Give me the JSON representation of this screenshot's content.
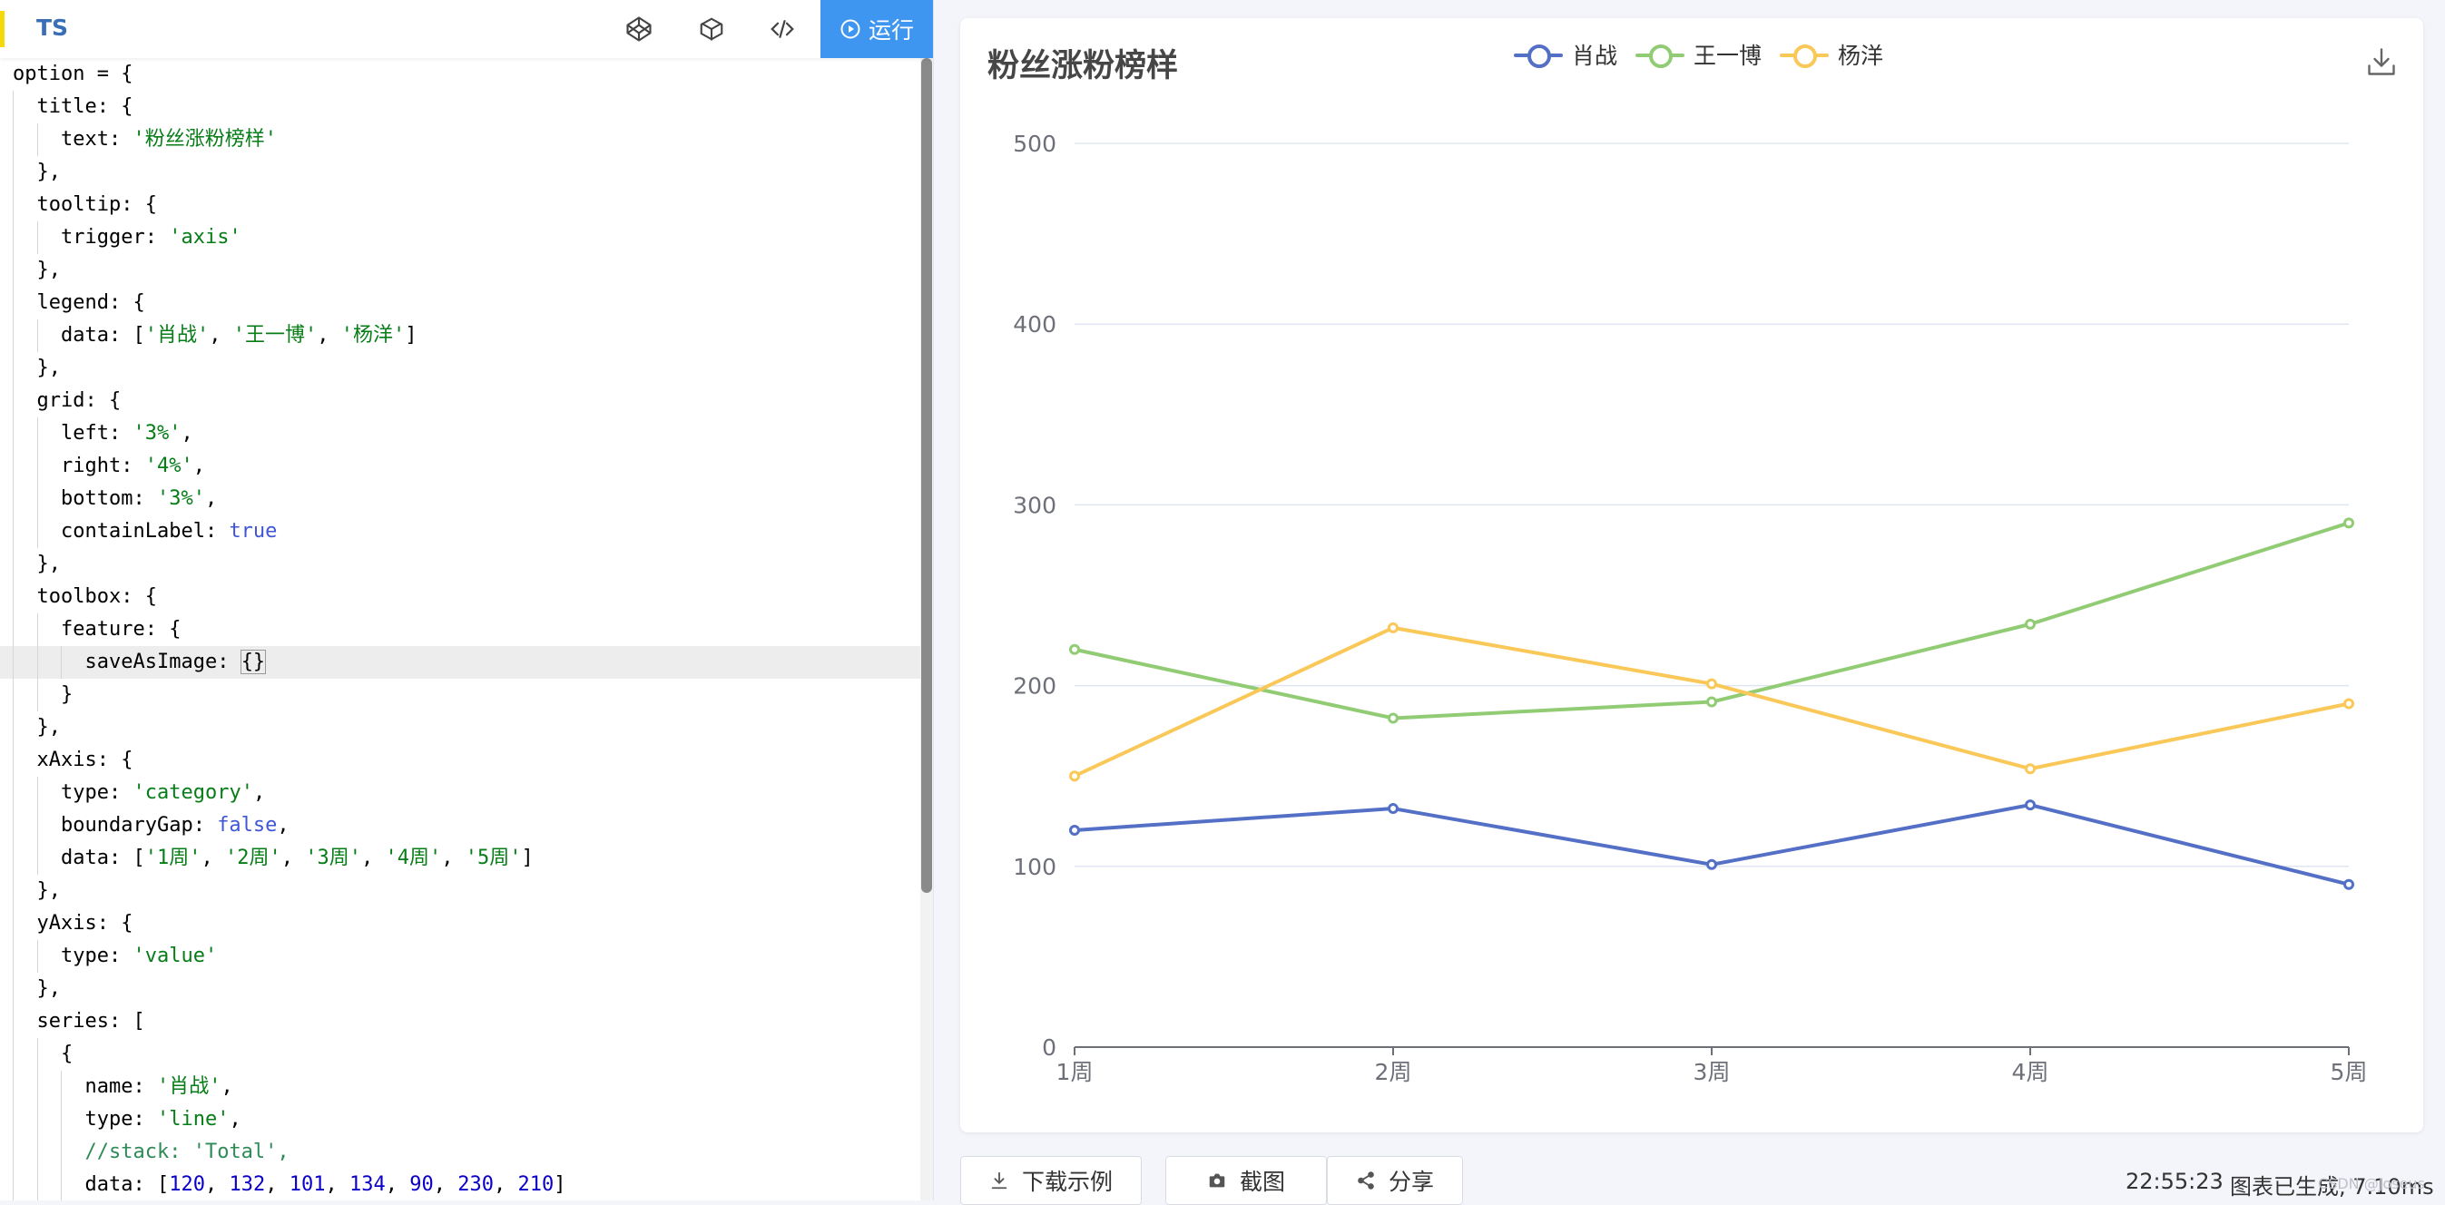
{
  "editor": {
    "language": "TS",
    "run_label": "运行",
    "toolbar_icons": [
      "codepen-icon",
      "box-icon",
      "code-icon"
    ],
    "code_lines": [
      {
        "indent": 0,
        "tokens": [
          {
            "t": "option = {"
          }
        ]
      },
      {
        "indent": 1,
        "tokens": [
          {
            "t": "title: {"
          }
        ]
      },
      {
        "indent": 2,
        "tokens": [
          {
            "t": "text: "
          },
          {
            "t": "'粉丝涨粉榜样'",
            "c": "str"
          }
        ]
      },
      {
        "indent": 1,
        "tokens": [
          {
            "t": "},"
          }
        ]
      },
      {
        "indent": 1,
        "tokens": [
          {
            "t": "tooltip: {"
          }
        ]
      },
      {
        "indent": 2,
        "tokens": [
          {
            "t": "trigger: "
          },
          {
            "t": "'axis'",
            "c": "str"
          }
        ]
      },
      {
        "indent": 1,
        "tokens": [
          {
            "t": "},"
          }
        ]
      },
      {
        "indent": 1,
        "tokens": [
          {
            "t": "legend: {"
          }
        ]
      },
      {
        "indent": 2,
        "tokens": [
          {
            "t": "data: ["
          },
          {
            "t": "'肖战'",
            "c": "str"
          },
          {
            "t": ", "
          },
          {
            "t": "'王一博'",
            "c": "str"
          },
          {
            "t": ", "
          },
          {
            "t": "'杨洋'",
            "c": "str"
          },
          {
            "t": "]"
          }
        ]
      },
      {
        "indent": 1,
        "tokens": [
          {
            "t": "},"
          }
        ]
      },
      {
        "indent": 1,
        "tokens": [
          {
            "t": "grid: {"
          }
        ]
      },
      {
        "indent": 2,
        "tokens": [
          {
            "t": "left: "
          },
          {
            "t": "'3%'",
            "c": "str"
          },
          {
            "t": ","
          }
        ]
      },
      {
        "indent": 2,
        "tokens": [
          {
            "t": "right: "
          },
          {
            "t": "'4%'",
            "c": "str"
          },
          {
            "t": ","
          }
        ]
      },
      {
        "indent": 2,
        "tokens": [
          {
            "t": "bottom: "
          },
          {
            "t": "'3%'",
            "c": "str"
          },
          {
            "t": ","
          }
        ]
      },
      {
        "indent": 2,
        "tokens": [
          {
            "t": "containLabel: "
          },
          {
            "t": "true",
            "c": "kw"
          }
        ]
      },
      {
        "indent": 1,
        "tokens": [
          {
            "t": "},"
          }
        ]
      },
      {
        "indent": 1,
        "tokens": [
          {
            "t": "toolbox: {"
          }
        ]
      },
      {
        "indent": 2,
        "tokens": [
          {
            "t": "feature: {"
          }
        ]
      },
      {
        "indent": 3,
        "hl": true,
        "tokens": [
          {
            "t": "saveAsImage: "
          },
          {
            "t": "{}",
            "c": "bracket"
          }
        ]
      },
      {
        "indent": 2,
        "tokens": [
          {
            "t": "}"
          }
        ]
      },
      {
        "indent": 1,
        "tokens": [
          {
            "t": "},"
          }
        ]
      },
      {
        "indent": 1,
        "tokens": [
          {
            "t": "xAxis: {"
          }
        ]
      },
      {
        "indent": 2,
        "tokens": [
          {
            "t": "type: "
          },
          {
            "t": "'category'",
            "c": "str"
          },
          {
            "t": ","
          }
        ]
      },
      {
        "indent": 2,
        "tokens": [
          {
            "t": "boundaryGap: "
          },
          {
            "t": "false",
            "c": "kw"
          },
          {
            "t": ","
          }
        ]
      },
      {
        "indent": 2,
        "tokens": [
          {
            "t": "data: ["
          },
          {
            "t": "'1周'",
            "c": "str"
          },
          {
            "t": ", "
          },
          {
            "t": "'2周'",
            "c": "str"
          },
          {
            "t": ", "
          },
          {
            "t": "'3周'",
            "c": "str"
          },
          {
            "t": ", "
          },
          {
            "t": "'4周'",
            "c": "str"
          },
          {
            "t": ", "
          },
          {
            "t": "'5周'",
            "c": "str"
          },
          {
            "t": "]"
          }
        ]
      },
      {
        "indent": 1,
        "tokens": [
          {
            "t": "},"
          }
        ]
      },
      {
        "indent": 1,
        "tokens": [
          {
            "t": "yAxis: {"
          }
        ]
      },
      {
        "indent": 2,
        "tokens": [
          {
            "t": "type: "
          },
          {
            "t": "'value'",
            "c": "str"
          }
        ]
      },
      {
        "indent": 1,
        "tokens": [
          {
            "t": "},"
          }
        ]
      },
      {
        "indent": 1,
        "tokens": [
          {
            "t": "series: ["
          }
        ]
      },
      {
        "indent": 2,
        "tokens": [
          {
            "t": "{"
          }
        ]
      },
      {
        "indent": 3,
        "tokens": [
          {
            "t": "name: "
          },
          {
            "t": "'肖战'",
            "c": "str"
          },
          {
            "t": ","
          }
        ]
      },
      {
        "indent": 3,
        "tokens": [
          {
            "t": "type: "
          },
          {
            "t": "'line'",
            "c": "str"
          },
          {
            "t": ","
          }
        ]
      },
      {
        "indent": 3,
        "tokens": [
          {
            "t": "//stack: 'Total',",
            "c": "cmt"
          }
        ]
      },
      {
        "indent": 3,
        "tokens": [
          {
            "t": "data: ["
          },
          {
            "t": "120",
            "c": "num"
          },
          {
            "t": ", "
          },
          {
            "t": "132",
            "c": "num"
          },
          {
            "t": ", "
          },
          {
            "t": "101",
            "c": "num"
          },
          {
            "t": ", "
          },
          {
            "t": "134",
            "c": "num"
          },
          {
            "t": ", "
          },
          {
            "t": "90",
            "c": "num"
          },
          {
            "t": ", "
          },
          {
            "t": "230",
            "c": "num"
          },
          {
            "t": ", "
          },
          {
            "t": "210",
            "c": "num"
          },
          {
            "t": "]"
          }
        ]
      }
    ]
  },
  "chart_data": {
    "type": "line",
    "title": "粉丝涨粉榜样",
    "categories": [
      "1周",
      "2周",
      "3周",
      "4周",
      "5周"
    ],
    "y_ticks": [
      "0",
      "100",
      "200",
      "300",
      "400",
      "500"
    ],
    "ylim": [
      0,
      500
    ],
    "grid": true,
    "legend_position": "top-center",
    "series": [
      {
        "name": "肖战",
        "color": "#5470c6",
        "values": [
          120,
          132,
          101,
          134,
          90
        ]
      },
      {
        "name": "王一博",
        "color": "#91cc75",
        "values": [
          220,
          182,
          191,
          234,
          290
        ]
      },
      {
        "name": "杨洋",
        "color": "#fac858",
        "values": [
          150,
          232,
          201,
          154,
          190
        ]
      }
    ]
  },
  "footer": {
    "download_label": "下载示例",
    "screenshot_label": "截图",
    "share_label": "分享",
    "time": "22:55:23",
    "status": "图表已生成, 7.10ms",
    "watermark": "CSDN @Joseus"
  }
}
